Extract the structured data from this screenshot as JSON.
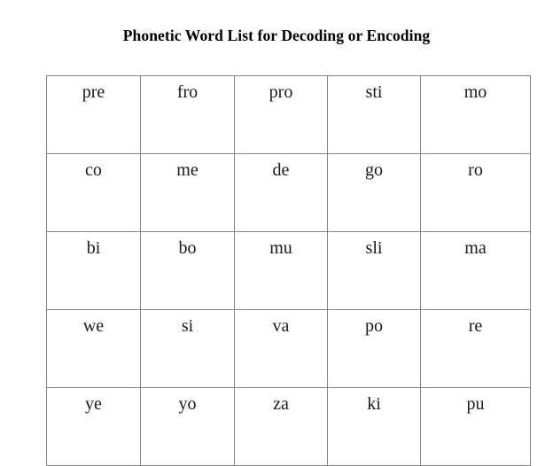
{
  "document": {
    "title": "Phonetic Word List for Decoding or Encoding",
    "background_color": "#ffffff",
    "text_color": "#000000",
    "border_color": "#868686"
  },
  "table": {
    "columns": 5,
    "rows": 5,
    "cells": [
      [
        "pre",
        "fro",
        "pro",
        "sti",
        "mo"
      ],
      [
        "co",
        "me",
        "de",
        "go",
        "ro"
      ],
      [
        "bi",
        "bo",
        "mu",
        "sli",
        "ma"
      ],
      [
        "we",
        "si",
        "va",
        "po",
        "re"
      ],
      [
        "ye",
        "yo",
        "za",
        "ki",
        "pu"
      ]
    ]
  }
}
